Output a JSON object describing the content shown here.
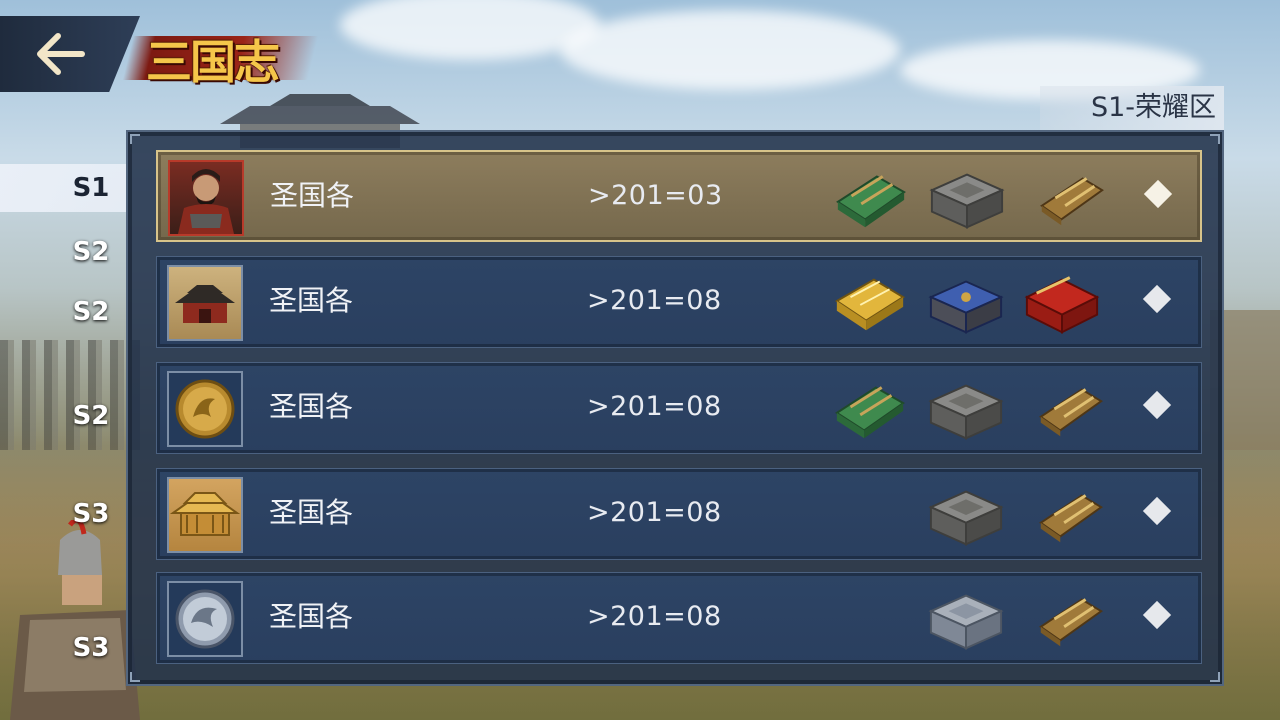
{
  "header": {
    "back_icon": "arrow-left-icon",
    "logo_text": "三国志",
    "zone_label": "S1-荣耀区"
  },
  "side_tabs": [
    {
      "label": "S1",
      "active": true
    },
    {
      "label": "S2",
      "active": false
    },
    {
      "label": "S2",
      "active": false
    },
    {
      "label": "S2",
      "active": false
    },
    {
      "label": "S3",
      "active": false
    },
    {
      "label": "S3",
      "active": false
    }
  ],
  "rows": [
    {
      "name": "圣国各",
      "date": ">201=03",
      "avatar": "general-portrait",
      "rewards": [
        "green-book-icon",
        "iron-chest-icon",
        "bronze-scroll-icon"
      ],
      "selected": true
    },
    {
      "name": "圣国各",
      "date": ">201=08",
      "avatar": "palace-gate",
      "rewards": [
        "gold-box-icon",
        "blue-chest-icon",
        "red-chest-icon"
      ],
      "selected": false
    },
    {
      "name": "圣国各",
      "date": ">201=08",
      "avatar": "golden-phoenix-emblem",
      "rewards": [
        "green-book-icon",
        "iron-chest-icon",
        "bronze-scroll-icon"
      ],
      "selected": false
    },
    {
      "name": "圣国各",
      "date": ">201=08",
      "avatar": "golden-palace",
      "rewards": [
        "iron-chest-icon",
        "bronze-scroll-icon"
      ],
      "selected": false
    },
    {
      "name": "圣国各",
      "date": ">201=08",
      "avatar": "silver-dragon-emblem",
      "rewards": [
        "silver-chest-icon",
        "bronze-scroll-icon"
      ],
      "selected": false
    }
  ],
  "colors": {
    "panel": "#22324b",
    "row": "#2d4465",
    "row_selected": "#8d7d5d",
    "logo_gold": "#f5c64a",
    "logo_red": "#9b2417"
  }
}
